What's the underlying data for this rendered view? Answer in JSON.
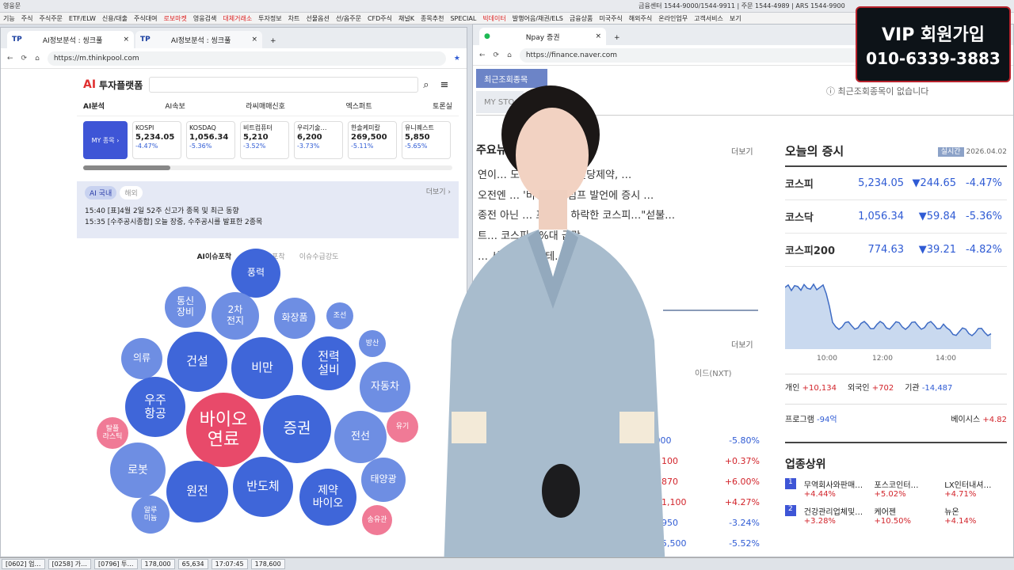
{
  "topbar": {
    "title": "영웅문",
    "right": "금융센터 1544-9000/1544-9911 | 주문 1544-4989 | ARS 1544-9900"
  },
  "menu": [
    "기능",
    "주식",
    "주식주문",
    "ETF/ELW",
    "신용/대출",
    "주식대여",
    "로보마켓",
    "영웅검색",
    "대체거래소",
    "투자정보",
    "차트",
    "선물옵션",
    "선/옵주문",
    "CFD주식",
    "채널K",
    "종목추천",
    "SPECIAL",
    "빅데이터",
    "발행어음/채권/ELS",
    "금융상품",
    "미국주식",
    "해외주식",
    "온라인업무",
    "고객서비스",
    "보기"
  ],
  "left": {
    "tabs": [
      "AI정보분석 : 씽크풀",
      "AI정보분석 : 씽크풀"
    ],
    "url": "https://m.thinkpool.com",
    "brand": "투자플랫폼",
    "nav": [
      "AI분석",
      "AI속보",
      "라씨매매신호",
      "엑스퍼트",
      "토론실"
    ],
    "my": "MY 종목 ›",
    "stocks": [
      {
        "name": "KOSPI",
        "value": "5,234.05",
        "chg": "-4.47%"
      },
      {
        "name": "KOSDAQ",
        "value": "1,056.34",
        "chg": "-5.36%"
      },
      {
        "name": "비트컴퓨터",
        "value": "5,210",
        "chg": "-3.52%"
      },
      {
        "name": "우리기술…",
        "value": "6,200",
        "chg": "-3.73%"
      },
      {
        "name": "한솔케미칼",
        "value": "269,500",
        "chg": "-5.11%"
      },
      {
        "name": "유니퀘스트",
        "value": "5,850",
        "chg": "-5.65%"
      }
    ],
    "newsTabs": [
      "AI 국내",
      "해외"
    ],
    "more": "더보기 ›",
    "news": [
      {
        "time": "15:40",
        "text": "[표]4월 2일 52주 신고가 종목 및 최근 동향"
      },
      {
        "time": "15:35",
        "text": "[수주공시종합] 오늘 장중, 수주공시를 발표한 2종목"
      }
    ],
    "issueTabs": [
      "AI이슈포착",
      "미국이슈포착",
      "이슈수급강도"
    ],
    "bubbles": [
      "풍력",
      "통신 장비",
      "2차 전지",
      "화장품",
      "조선",
      "의류",
      "건설",
      "비만",
      "전력 설비",
      "방산",
      "자동차",
      "우주 항공",
      "바이오 연료",
      "증권",
      "전선",
      "유기",
      "탈플 라스틱",
      "로봇",
      "원전",
      "반도체",
      "제약 바이오",
      "태양광",
      "알루 미늄",
      "송유관"
    ]
  },
  "right": {
    "tab": "Npay 증권",
    "url": "https://finance.naver.com",
    "recent": "최근조회종목",
    "my": "MY STO",
    "noRecent": "최근조회종목이 없습니다",
    "mainTitle": "주요뉴",
    "more": "더보기",
    "newsLines": [
      "연이… 도 '역부족'…삼천당제약, …",
      "오전엔 … '비명'…트럼프 발언에 증시 …",
      "종전 아닌 … 프 입에 하락한 코스피…\"섣불…",
      "트… 코스피 4%대 급락",
      "… 사명 변경도 테…",
      "… 와…국내 투자…"
    ],
    "nxt": "이드(NXT)",
    "rows": [
      {
        "a": ",000",
        "b": "-5.80%"
      },
      {
        "a": "▲ 100",
        "b": "+0.37%"
      },
      {
        "a": "▲ 870",
        "b": "+6.00%"
      },
      {
        "a": "▲ 1,100",
        "b": "+4.27%"
      },
      {
        "a": "▼ 950",
        "b": "-3.24%"
      },
      {
        "a": "▼ 5,500",
        "b": "-5.52%"
      }
    ],
    "today": "오늘의 증시",
    "realtime": "실시간",
    "date": "2026.04.02",
    "indices": [
      {
        "name": "코스피",
        "value": "5,234.05",
        "chg": "▼244.65",
        "pct": "-4.47%"
      },
      {
        "name": "코스닥",
        "value": "1,056.34",
        "chg": "▼59.84",
        "pct": "-5.36%"
      },
      {
        "name": "코스피200",
        "value": "774.63",
        "chg": "▼39.21",
        "pct": "-4.82%"
      }
    ],
    "chart_x": [
      "10:00",
      "12:00",
      "14:00"
    ],
    "flows": [
      {
        "k": "개인",
        "v": "+10,134"
      },
      {
        "k": "외국인",
        "v": "+702"
      },
      {
        "k": "기관",
        "v": "-14,487"
      }
    ],
    "program": "프로그램",
    "programV": "-94억",
    "basis": "베이시스",
    "basisV": "+4.82",
    "sectorTitle": "업종상위",
    "sectors": [
      {
        "rank": "1",
        "items": [
          {
            "n": "무역회사와판매…",
            "p": "+4.44%"
          },
          {
            "n": "포스코인터…",
            "p": "+5.02%"
          },
          {
            "n": "LX인터내셔…",
            "p": "+4.71%"
          }
        ]
      },
      {
        "rank": "2",
        "items": [
          {
            "n": "건강관리업체및…",
            "p": "+3.28%"
          },
          {
            "n": "케어젠",
            "p": "+10.50%"
          },
          {
            "n": "뉴온",
            "p": "+4.14%"
          }
        ]
      }
    ]
  },
  "vip": {
    "line1": "VIP 회원가입",
    "line2": "010-6339-3883"
  },
  "bottom": [
    "[0602] 업…",
    "[0258] 가…",
    "[0796] 투…",
    "178,000",
    "65,634",
    "17:07:45",
    "178,600"
  ]
}
